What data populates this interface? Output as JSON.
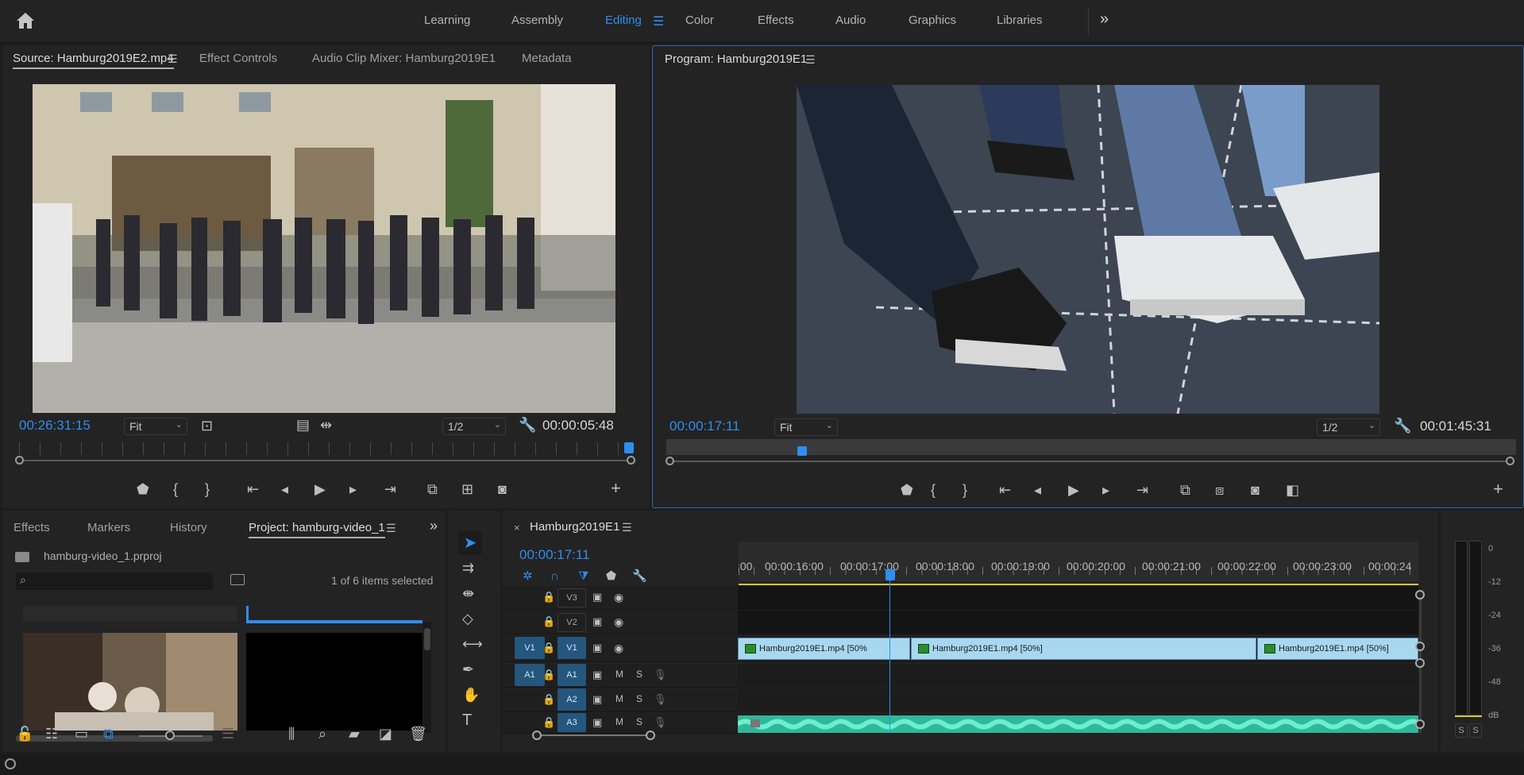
{
  "topbar": {
    "workspaces": [
      "Learning",
      "Assembly",
      "Editing",
      "Color",
      "Effects",
      "Audio",
      "Graphics",
      "Libraries"
    ],
    "active": "Editing"
  },
  "source": {
    "tabs": [
      "Source: Hamburg2019E2.mp4",
      "Effect Controls",
      "Audio Clip Mixer: Hamburg2019E1",
      "Metadata"
    ],
    "timecode": "00:26:31:15",
    "fit": "Fit",
    "resolution": "1/2",
    "duration": "00:00:05:48"
  },
  "program": {
    "title": "Program: Hamburg2019E1",
    "timecode": "00:00:17:11",
    "fit": "Fit",
    "resolution": "1/2",
    "duration": "00:01:45:31"
  },
  "project": {
    "tabs": [
      "Effects",
      "Markers",
      "History",
      "Project: hamburg-video_1"
    ],
    "file": "hamburg-video_1.prproj",
    "search_placeholder": "",
    "selection": "1 of 6 items selected"
  },
  "timeline": {
    "sequence": "Hamburg2019E1",
    "timecode": "00:00:17:11",
    "ruler": [
      ":00",
      "00:00:16:00",
      "00:00:17:00",
      "00:00:18:00",
      "00:00:19:00",
      "00:00:20:00",
      "00:00:21:00",
      "00:00:22:00",
      "00:00:23:00",
      "00:00:24"
    ],
    "video_tracks": [
      "V3",
      "V2",
      "V1"
    ],
    "audio_tracks": [
      "A1",
      "A2",
      "A3"
    ],
    "src_v": "V1",
    "src_a": "A1",
    "m": "M",
    "s": "S",
    "clips": [
      "Hamburg2019E1.mp4 [50%",
      "Hamburg2019E1.mp4 [50%]",
      "Hamburg2019E1.mp4 [50%]"
    ]
  },
  "meter": {
    "scale": [
      "0",
      "-12",
      "-24",
      "-36",
      "-48",
      "dB"
    ],
    "s1": "S",
    "s2": "S"
  },
  "colors": {
    "accent": "#2e8ef0",
    "clip": "#a8d8f0",
    "audio": "#3fd8b0",
    "playhead": "#2e8ef0"
  }
}
